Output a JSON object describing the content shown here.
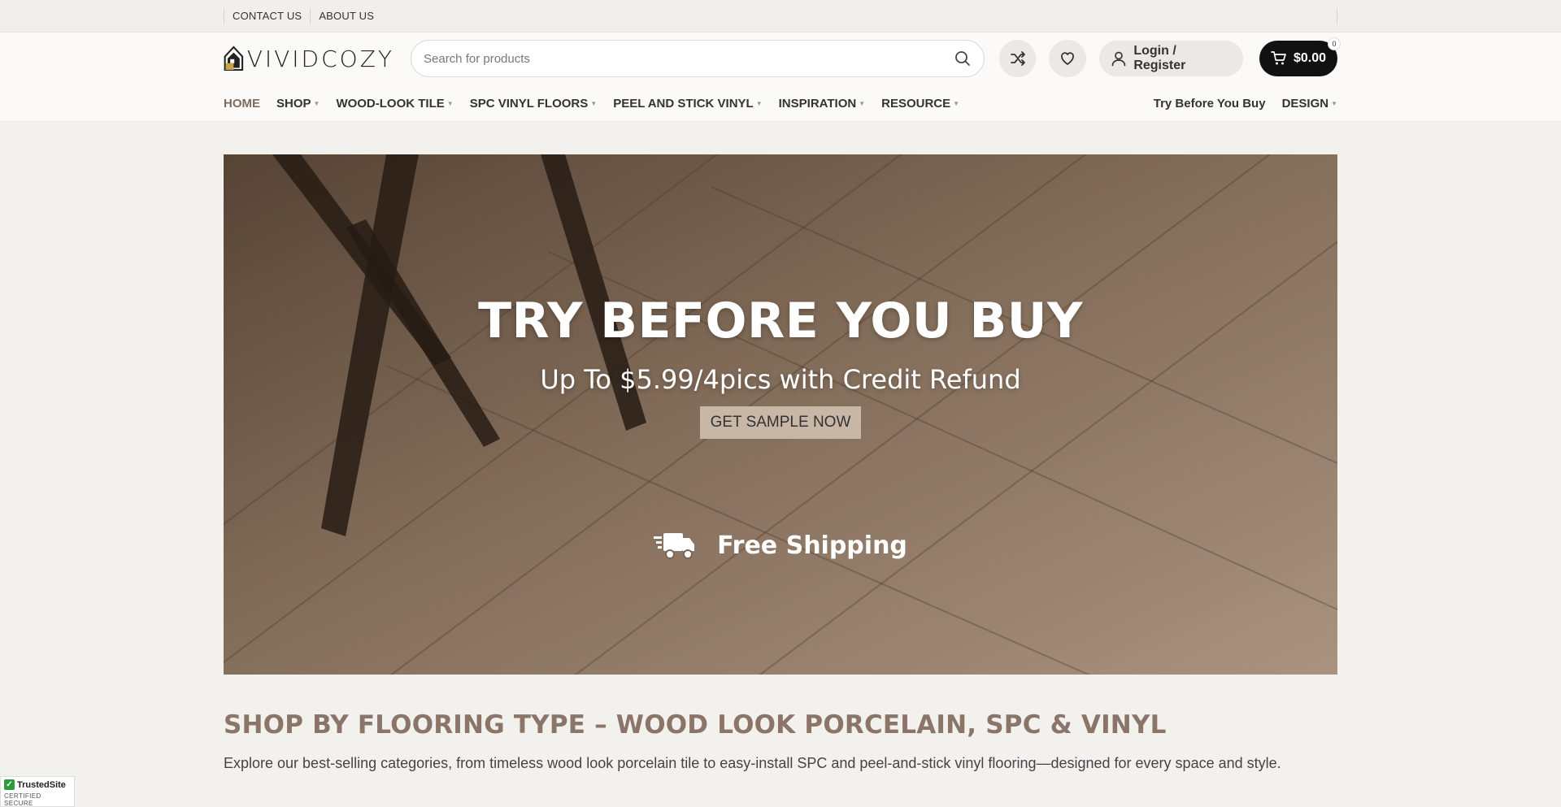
{
  "topbar": {
    "links": [
      "CONTACT US",
      "ABOUT US"
    ]
  },
  "header": {
    "logo_text": "VIVIDCOZY",
    "search_placeholder": "Search for products",
    "login_label": "Login / Register",
    "cart_total": "$0.00",
    "cart_count": "0"
  },
  "nav": {
    "items": [
      {
        "label": "HOME"
      },
      {
        "label": "SHOP"
      },
      {
        "label": "WOOD-LOOK TILE"
      },
      {
        "label": "SPC VINYL FLOORS"
      },
      {
        "label": "PEEL AND STICK VINYL"
      },
      {
        "label": "INSPIRATION"
      },
      {
        "label": "RESOURCE"
      }
    ],
    "right_items": [
      {
        "label": " Try Before You Buy"
      },
      {
        "label": "DESIGN"
      }
    ]
  },
  "hero": {
    "title": "TRY BEFORE YOU BUY",
    "subtitle": "Up To $5.99/4pics with Credit Refund",
    "cta_label": "GET SAMPLE NOW",
    "shipping_text": "Free Shipping"
  },
  "section": {
    "title": "SHOP BY FLOORING TYPE – WOOD LOOK PORCELAIN, SPC & VINYL",
    "description": "Explore our best-selling categories, from timeless wood look porcelain tile to easy-install SPC and peel-and-stick vinyl flooring—designed for every space and style."
  },
  "badge": {
    "name": "TrustedSite",
    "caption": "CERTIFIED SECURE"
  },
  "colors": {
    "accent": "#7d6b60",
    "section_title": "#8b7569",
    "cart_bg": "#111111",
    "cta_bg": "#c8b6a7"
  }
}
